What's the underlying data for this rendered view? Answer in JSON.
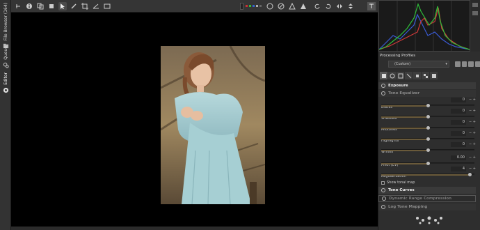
{
  "left_tabs": {
    "file_browser": "File Browser (164)",
    "queue": "Queue",
    "editor": "Editor"
  },
  "toolbar": {
    "icons": [
      "history-icon",
      "info-icon",
      "copy-icon",
      "pointer-icon",
      "picker-icon",
      "crop-icon",
      "straighten-icon",
      "transform-icon",
      "preview-icon",
      "zoom-icons"
    ]
  },
  "right_panel": {
    "processing_profiles_label": "Processing Profiles",
    "profile_value": "(Custom)",
    "sections": {
      "exposure": "Exposure",
      "tone_equalizer": "Tone Equalizer",
      "tone_curves": "Tone Curves",
      "dynamic_range": "Dynamic Range Compression",
      "log_tone": "Log Tone Mapping"
    },
    "sliders": [
      {
        "label": "Blacks",
        "value": "0",
        "level": 0.5
      },
      {
        "label": "Shadows",
        "value": "0",
        "level": 0.5
      },
      {
        "label": "Midtones",
        "value": "0",
        "level": 0.5
      },
      {
        "label": "Highlights",
        "value": "0",
        "level": 0.5
      },
      {
        "label": "Whites",
        "value": "0",
        "level": 0.5
      },
      {
        "label": "Pivot (EV)",
        "value": "0.00",
        "level": 0.5
      },
      {
        "label": "Regularization",
        "value": "4",
        "level": 0.95
      }
    ],
    "show_tonal_map": "Show tonal map"
  },
  "colors": {
    "histogram_red": "#d23a3a",
    "histogram_green": "#2fbf3a",
    "histogram_blue": "#3a5bd6",
    "accent_slider": "#6a5a3a"
  }
}
